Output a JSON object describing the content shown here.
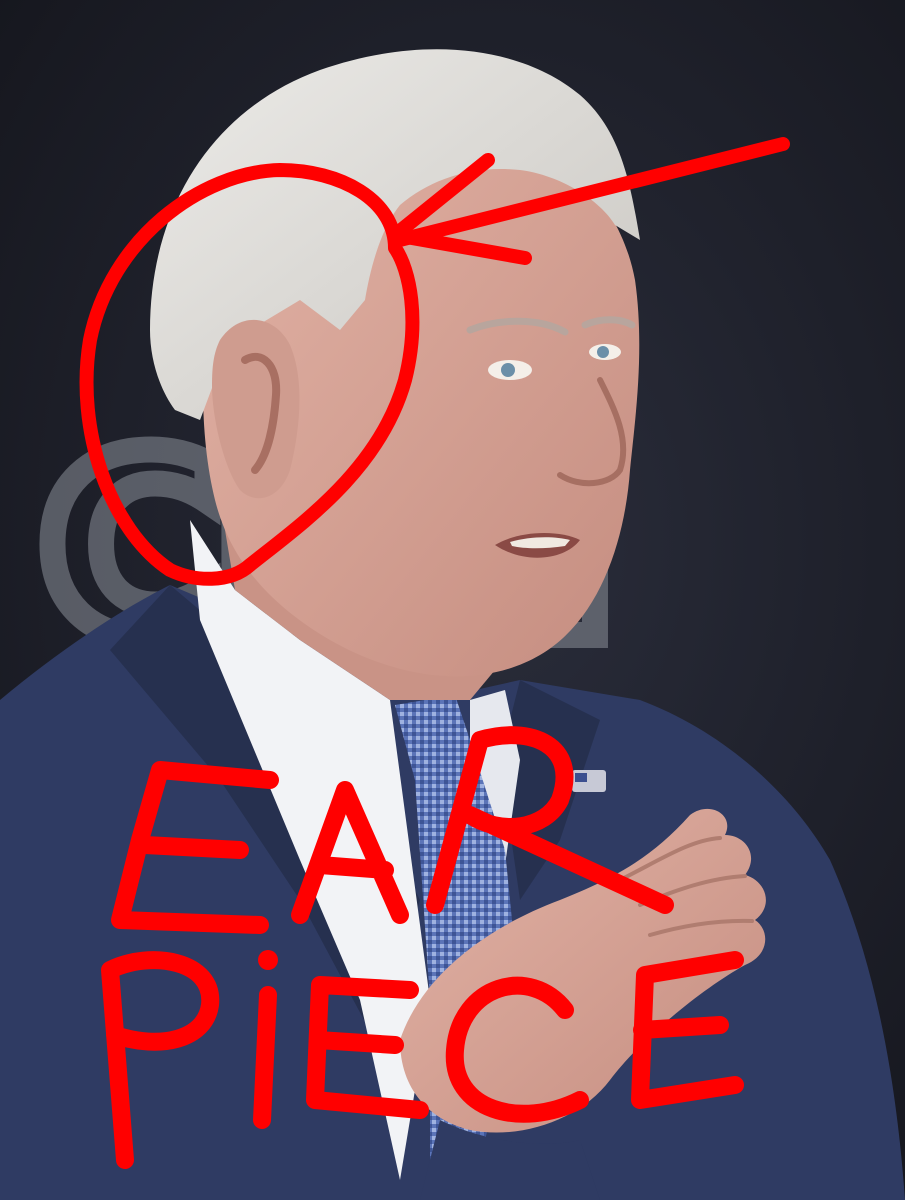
{
  "photo": {
    "backdrop_logo_text": "CNN",
    "colors": {
      "backdrop": "#1d1f2a",
      "backdrop_logo": "#8a8f98",
      "suit": "#2f3b63",
      "shirt": "#f2f3f6",
      "tie": "#5b74b8",
      "skin": "#d9a79a",
      "hair": "#dedcd8"
    }
  },
  "annotation": {
    "text_line_1": "EAR",
    "text_line_2": "PIECE",
    "ink_color": "#ff0000"
  }
}
